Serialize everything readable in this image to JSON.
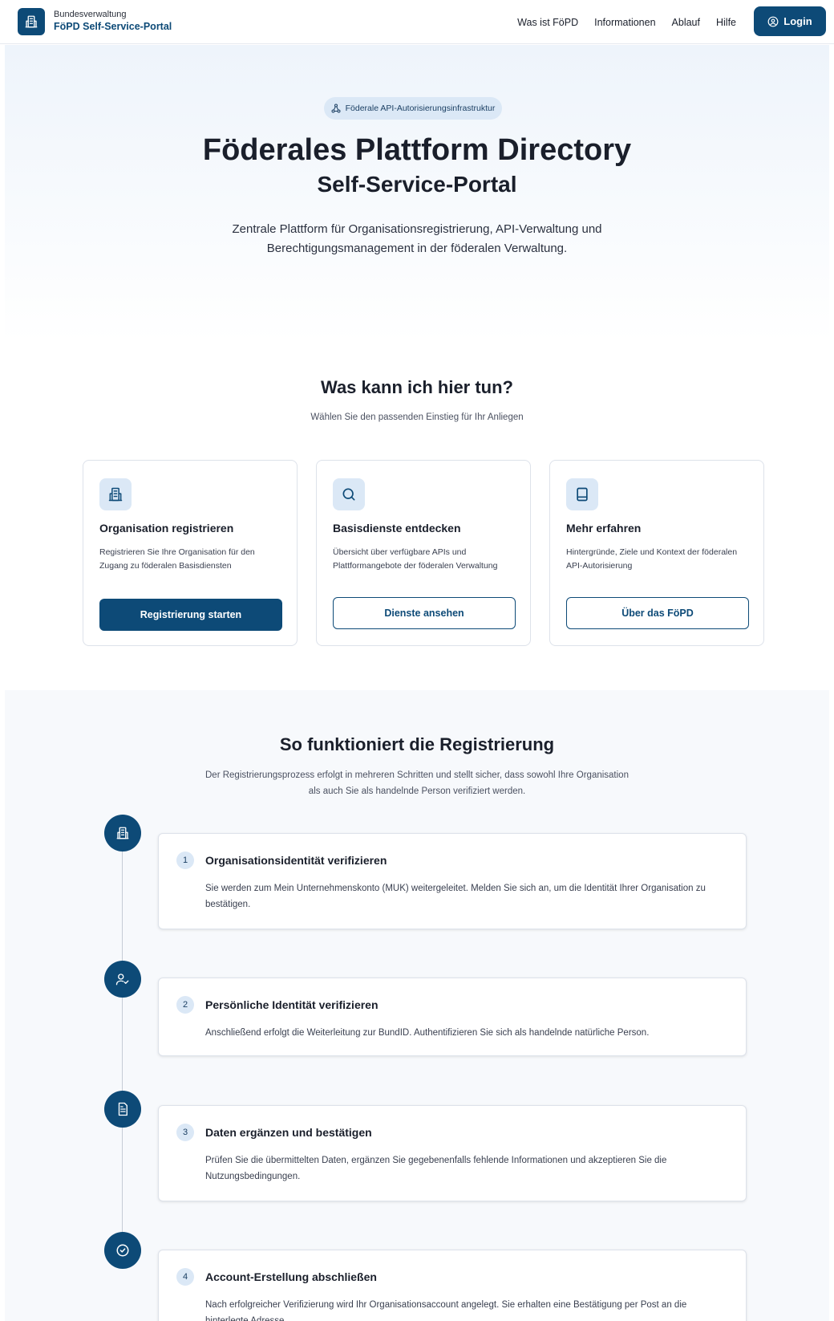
{
  "header": {
    "brand_sub": "Bundesverwaltung",
    "brand_title": "FöPD Self-Service-Portal",
    "nav": [
      "Was ist FöPD",
      "Informationen",
      "Ablauf",
      "Hilfe"
    ],
    "login_label": "Login"
  },
  "hero": {
    "pill": "Föderale API-Autorisierungsinfrastruktur",
    "title": "Föderales Plattform Directory",
    "subtitle": "Self-Service-Portal",
    "description": "Zentrale Plattform für Organisationsregistrierung, API-Verwaltung und Berechtigungsmanagement in der föderalen Verwaltung."
  },
  "actions": {
    "title": "Was kann ich hier tun?",
    "subtitle": "Wählen Sie den passenden Einstieg für Ihr Anliegen",
    "cards": [
      {
        "icon": "building-icon",
        "title": "Organisation registrieren",
        "description": "Registrieren Sie Ihre Organisation für den Zugang zu föderalen Basisdiensten",
        "button": "Registrierung starten"
      },
      {
        "icon": "search-icon",
        "title": "Basisdienste entdecken",
        "description": "Übersicht über verfügbare APIs und Plattformangebote der föderalen Verwaltung",
        "button": "Dienste ansehen"
      },
      {
        "icon": "book-icon",
        "title": "Mehr erfahren",
        "description": "Hintergründe, Ziele und Kontext der föderalen API-Autorisierung",
        "button": "Über das FöPD"
      }
    ]
  },
  "registration": {
    "title": "So funktioniert die Registrierung",
    "subtitle": "Der Registrierungsprozess erfolgt in mehreren Schritten und stellt sicher, dass sowohl Ihre Organisation als auch Sie als handelnde Person verifiziert werden.",
    "steps": [
      {
        "number": "1",
        "icon": "building-icon",
        "title": "Organisationsidentität verifizieren",
        "description": "Sie werden zum Mein Unternehmenskonto (MUK) weitergeleitet. Melden Sie sich an, um die Identität Ihrer Organisation zu bestätigen."
      },
      {
        "number": "2",
        "icon": "user-check-icon",
        "title": "Persönliche Identität verifizieren",
        "description": "Anschließend erfolgt die Weiterleitung zur BundID. Authentifizieren Sie sich als handelnde natürliche Person."
      },
      {
        "number": "3",
        "icon": "document-icon",
        "title": "Daten ergänzen und bestätigen",
        "description": "Prüfen Sie die übermittelten Daten, ergänzen Sie gegebenenfalls fehlende Informationen und akzeptieren Sie die Nutzungsbedingungen."
      },
      {
        "number": "4",
        "icon": "check-circle-icon",
        "title": "Account-Erstellung abschließen",
        "description": "Nach erfolgreicher Verifizierung wird Ihr Organisationsaccount angelegt. Sie erhalten eine Bestätigung per Post an die hinterlegte Adresse."
      }
    ]
  }
}
